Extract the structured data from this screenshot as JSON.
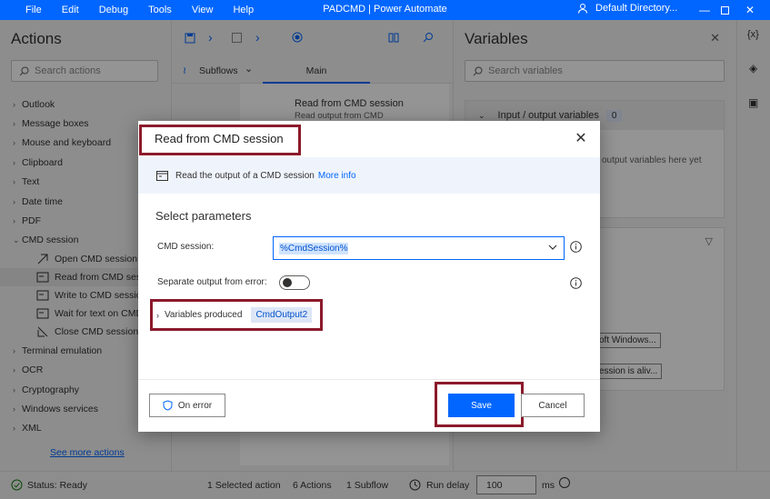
{
  "titlebar": {
    "menu": [
      "File",
      "Edit",
      "Debug",
      "Tools",
      "View",
      "Help"
    ],
    "title": "PADCMD | Power Automate",
    "directory": "Default Directory..."
  },
  "actions_pane": {
    "title": "Actions",
    "search_placeholder": "Search actions",
    "categories_top": [
      "Outlook",
      "Message boxes",
      "Mouse and keyboard",
      "Clipboard",
      "Text",
      "Date time",
      "PDF",
      "CMD session"
    ],
    "cmd_items": [
      "Open CMD session",
      "Read from CMD session",
      "Write to CMD session",
      "Wait for text on CMD session",
      "Close CMD session"
    ],
    "categories_bottom": [
      "Terminal emulation",
      "OCR",
      "Cryptography",
      "Windows services",
      "XML"
    ],
    "see_more": "See more actions"
  },
  "flow": {
    "subflows": "Subflows",
    "main_tab": "Main",
    "step_title": "Read from CMD session",
    "step_desc": "Read output from CMD"
  },
  "variables_pane": {
    "title": "Variables",
    "search_placeholder": "Search variables",
    "io_header": "Input / output variables",
    "io_count": "0",
    "io_empty": "output variables here yet",
    "chip1": "oft Windows...",
    "chip2": "ession is aliv..."
  },
  "status": {
    "status": "Status: Ready",
    "selected": "1 Selected action",
    "actions": "6 Actions",
    "subflow": "1 Subflow",
    "run_delay_label": "Run delay",
    "run_delay_value": "100",
    "ms": "ms"
  },
  "dialog": {
    "title": "Read from CMD session",
    "description": "Read the output of a CMD session",
    "more_info": "More info",
    "section_title": "Select parameters",
    "cmd_session_label": "CMD session:",
    "cmd_session_value": "%CmdSession%",
    "separate_label": "Separate output from error:",
    "variables_produced": "Variables produced",
    "variable_chip": "CmdOutput2",
    "on_error": "On error",
    "save": "Save",
    "cancel": "Cancel"
  },
  "colors": {
    "accent": "#0066ff",
    "highlight": "#8b1a2b"
  }
}
